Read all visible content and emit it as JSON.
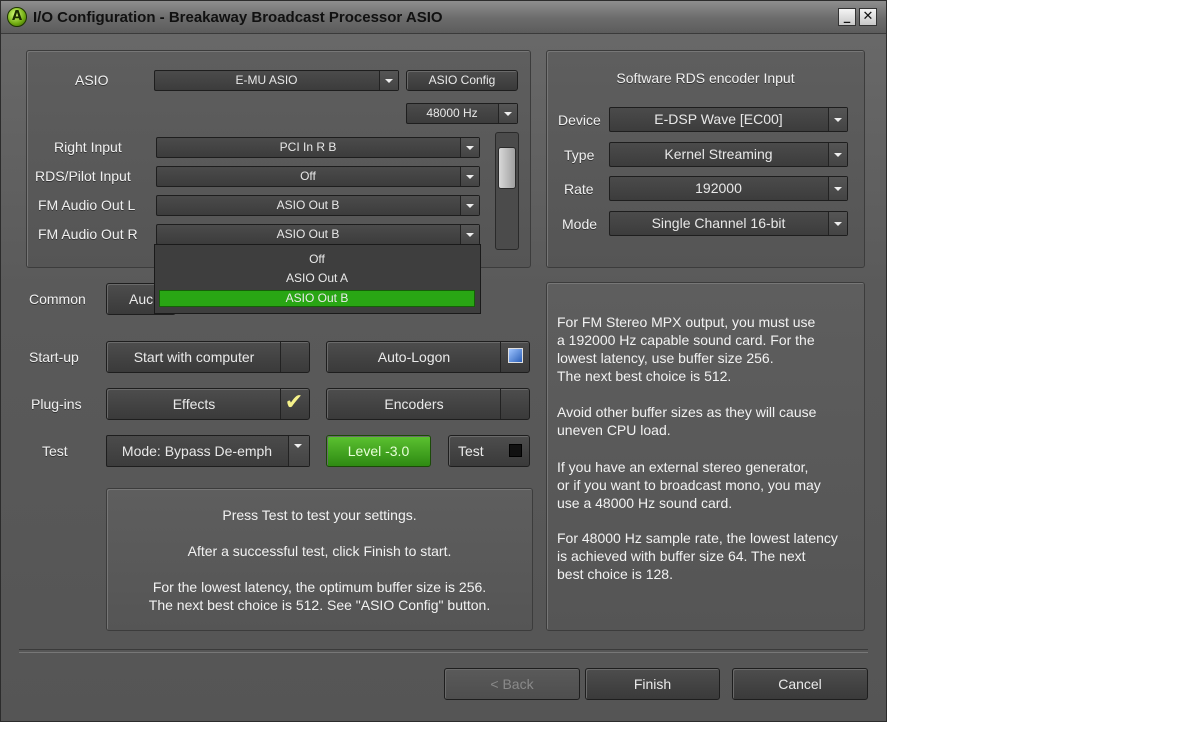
{
  "window": {
    "title": "I/O Configuration - Breakaway Broadcast Processor ASIO",
    "minimize_glyph": "_",
    "close_glyph": "✕"
  },
  "io_panel": {
    "asio_label": "ASIO",
    "asio_device": "E-MU ASIO",
    "asio_config_label": "ASIO Config",
    "sample_rate": "48000 Hz",
    "rows": [
      {
        "label": "Right Input",
        "value": "PCI In R B"
      },
      {
        "label": "RDS/Pilot Input",
        "value": "Off"
      },
      {
        "label": "FM Audio Out L",
        "value": "ASIO Out B"
      },
      {
        "label": "FM Audio Out R",
        "value": "ASIO Out B"
      }
    ],
    "dropdown_options": [
      "Off",
      "ASIO Out A",
      "ASIO Out B"
    ],
    "dropdown_selected": "ASIO Out B"
  },
  "rds_panel": {
    "title": "Software RDS encoder Input",
    "rows": [
      {
        "label": "Device",
        "value": "E-DSP Wave [EC00]"
      },
      {
        "label": "Type",
        "value": "Kernel Streaming"
      },
      {
        "label": "Rate",
        "value": "192000"
      },
      {
        "label": "Mode",
        "value": "Single Channel 16-bit"
      }
    ]
  },
  "options": {
    "common_label": "Common",
    "common_button": "Auc",
    "startup_label": "Start-up",
    "start_with_computer": "Start with computer",
    "auto_logon": "Auto-Logon",
    "plugins_label": "Plug-ins",
    "effects": "Effects",
    "effects_check": "✔",
    "encoders": "Encoders",
    "test_label": "Test",
    "test_mode": "Mode: Bypass De-emph",
    "level": "Level -3.0",
    "test_button": "Test"
  },
  "test_info": {
    "line1": "Press Test to test your settings.",
    "line2": "After a successful test, click Finish to start.",
    "line3": "For the lowest latency, the optimum buffer size is 256.",
    "line4": "The next best choice is 512. See \"ASIO Config\" button."
  },
  "info_panel": {
    "paragraphs": [
      [
        "For FM Stereo MPX output, you must use",
        "a 192000 Hz capable sound card. For the",
        "lowest latency, use buffer size 256.",
        "The next best choice is 512."
      ],
      [
        "Avoid other buffer sizes as they will cause",
        "uneven CPU load."
      ],
      [
        "If you have an external stereo generator,",
        "or if you want to broadcast mono, you may",
        "use a 48000 Hz sound card."
      ],
      [
        "For 48000 Hz sample rate, the lowest latency",
        "is achieved with buffer size 64. The next",
        "best choice is 128."
      ]
    ]
  },
  "footer": {
    "back": "< Back",
    "finish": "Finish",
    "cancel": "Cancel"
  },
  "colors": {
    "accent_green": "#2e8a12",
    "selection_green": "#29a614",
    "panel_gray": "#5a5a5a"
  }
}
